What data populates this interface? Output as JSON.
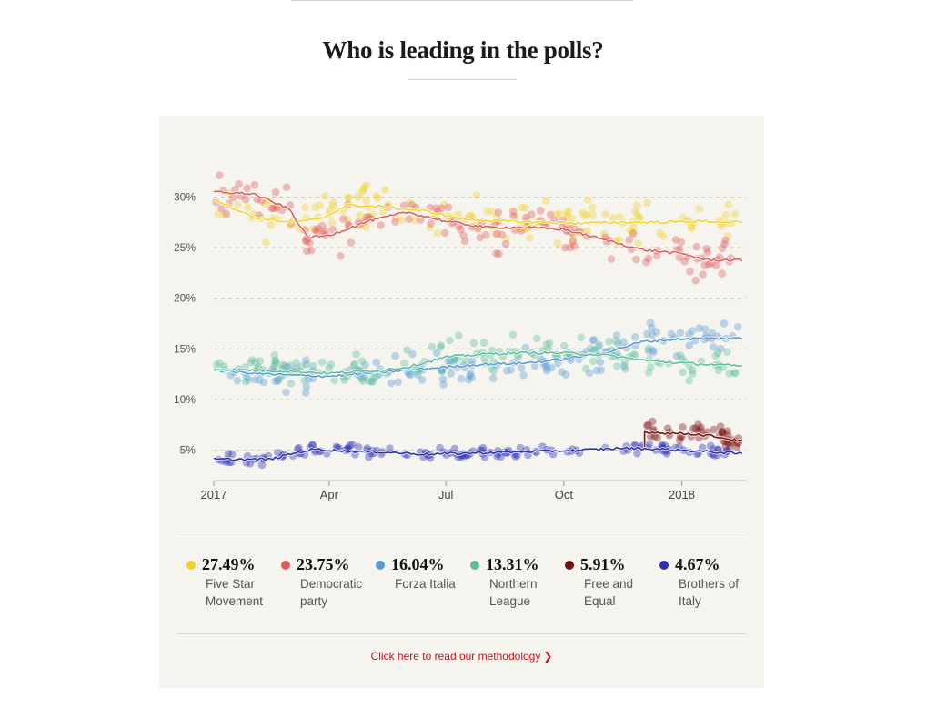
{
  "title": "Who is leading in the polls?",
  "methodology_link": "Click here to read our methodology",
  "methodology_chevron": "❯",
  "chart_data": {
    "type": "scatter",
    "title": "Who is leading in the polls?",
    "ylabel": "",
    "xlabel": "",
    "ylim": [
      2,
      33
    ],
    "xlim": [
      "2017-01-01",
      "2018-02-20"
    ],
    "y_ticks": [
      {
        "value": 5,
        "label": "5%"
      },
      {
        "value": 10,
        "label": "10%"
      },
      {
        "value": 15,
        "label": "15%"
      },
      {
        "value": 20,
        "label": "20%"
      },
      {
        "value": 25,
        "label": "25%"
      },
      {
        "value": 30,
        "label": "30%"
      }
    ],
    "x_ticks": [
      {
        "value": "2017-01-01",
        "label": "2017"
      },
      {
        "value": "2017-04-01",
        "label": "Apr"
      },
      {
        "value": "2017-07-01",
        "label": "Jul"
      },
      {
        "value": "2017-10-01",
        "label": "Oct"
      },
      {
        "value": "2018-01-01",
        "label": "2018"
      }
    ],
    "grid": "horizontal dashed",
    "series": [
      {
        "name": "Five Star Movement",
        "latest": "27.49%",
        "color": "#f2d22e",
        "trend": [
          [
            "2017-01-01",
            29.8
          ],
          [
            "2017-02-01",
            28.0
          ],
          [
            "2017-03-01",
            27.5
          ],
          [
            "2017-03-25",
            27.8
          ],
          [
            "2017-04-15",
            29.2
          ],
          [
            "2017-05-15",
            29.0
          ],
          [
            "2017-06-15",
            28.6
          ],
          [
            "2017-07-15",
            27.8
          ],
          [
            "2017-08-15",
            27.6
          ],
          [
            "2017-09-15",
            27.5
          ],
          [
            "2017-10-15",
            27.4
          ],
          [
            "2017-11-15",
            27.5
          ],
          [
            "2017-12-15",
            27.5
          ],
          [
            "2018-01-15",
            27.6
          ],
          [
            "2018-02-15",
            27.49
          ]
        ],
        "spread": 1.7
      },
      {
        "name": "Democratic party",
        "latest": "23.75%",
        "color": "#e05d5d",
        "trend": [
          [
            "2017-01-01",
            30.5
          ],
          [
            "2017-02-01",
            30.3
          ],
          [
            "2017-03-01",
            28.8
          ],
          [
            "2017-03-15",
            26.0
          ],
          [
            "2017-04-01",
            26.2
          ],
          [
            "2017-05-01",
            27.6
          ],
          [
            "2017-06-01",
            28.5
          ],
          [
            "2017-07-01",
            27.6
          ],
          [
            "2017-08-01",
            27.0
          ],
          [
            "2017-09-01",
            27.0
          ],
          [
            "2017-10-01",
            26.8
          ],
          [
            "2017-11-01",
            25.8
          ],
          [
            "2017-12-01",
            24.8
          ],
          [
            "2018-01-01",
            24.4
          ],
          [
            "2018-01-20",
            23.8
          ],
          [
            "2018-02-15",
            23.75
          ]
        ],
        "spread": 1.7
      },
      {
        "name": "Forza Italia",
        "latest": "16.04%",
        "color": "#5b9bd5",
        "trend": [
          [
            "2017-01-01",
            12.9
          ],
          [
            "2017-02-01",
            12.6
          ],
          [
            "2017-03-01",
            12.4
          ],
          [
            "2017-04-01",
            12.3
          ],
          [
            "2017-05-01",
            12.6
          ],
          [
            "2017-06-01",
            12.9
          ],
          [
            "2017-07-01",
            13.2
          ],
          [
            "2017-08-01",
            13.5
          ],
          [
            "2017-09-01",
            13.6
          ],
          [
            "2017-10-01",
            14.0
          ],
          [
            "2017-11-01",
            14.6
          ],
          [
            "2017-12-01",
            15.7
          ],
          [
            "2018-01-01",
            16.0
          ],
          [
            "2018-02-15",
            16.04
          ]
        ],
        "spread": 1.3
      },
      {
        "name": "Northern League",
        "latest": "13.31%",
        "color": "#5cbf9a",
        "trend": [
          [
            "2017-01-01",
            13.0
          ],
          [
            "2017-02-01",
            12.9
          ],
          [
            "2017-03-01",
            12.8
          ],
          [
            "2017-04-01",
            12.6
          ],
          [
            "2017-05-01",
            12.8
          ],
          [
            "2017-06-01",
            13.2
          ],
          [
            "2017-07-01",
            14.2
          ],
          [
            "2017-08-01",
            14.5
          ],
          [
            "2017-09-01",
            14.6
          ],
          [
            "2017-10-01",
            14.6
          ],
          [
            "2017-11-01",
            14.4
          ],
          [
            "2017-12-01",
            13.9
          ],
          [
            "2018-01-01",
            13.6
          ],
          [
            "2018-02-15",
            13.31
          ]
        ],
        "spread": 1.3
      },
      {
        "name": "Free and Equal",
        "latest": "5.91%",
        "color": "#7a1010",
        "start": "2017-12-03",
        "trend": [
          [
            "2017-12-03",
            6.8
          ],
          [
            "2017-12-20",
            6.7
          ],
          [
            "2018-01-10",
            6.6
          ],
          [
            "2018-01-25",
            6.4
          ],
          [
            "2018-02-15",
            5.91
          ]
        ],
        "spread": 0.8
      },
      {
        "name": "Brothers of Italy",
        "latest": "4.67%",
        "color": "#2b2fb8",
        "trend": [
          [
            "2017-01-01",
            4.1
          ],
          [
            "2017-02-15",
            4.1
          ],
          [
            "2017-03-01",
            4.6
          ],
          [
            "2017-03-20",
            5.1
          ],
          [
            "2017-04-15",
            4.9
          ],
          [
            "2017-05-15",
            4.8
          ],
          [
            "2017-06-15",
            4.6
          ],
          [
            "2017-07-15",
            4.7
          ],
          [
            "2017-08-15",
            4.8
          ],
          [
            "2017-09-15",
            4.9
          ],
          [
            "2017-10-15",
            5.0
          ],
          [
            "2017-11-15",
            5.2
          ],
          [
            "2017-12-15",
            5.1
          ],
          [
            "2018-01-15",
            4.9
          ],
          [
            "2018-02-15",
            4.67
          ]
        ],
        "spread": 0.5
      }
    ]
  }
}
